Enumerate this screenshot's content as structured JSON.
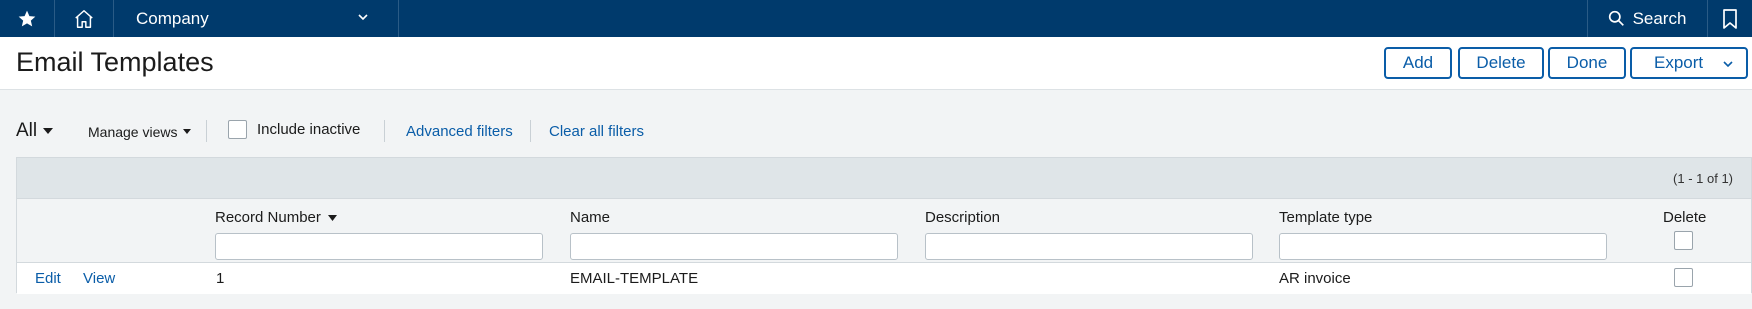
{
  "nav": {
    "star_icon": "star-icon",
    "home_icon": "home-icon",
    "company_label": "Company",
    "search_label": "Search",
    "bookmark_icon": "bookmark-icon"
  },
  "header": {
    "title": "Email Templates",
    "buttons": {
      "add": "Add",
      "delete": "Delete",
      "done": "Done",
      "export": "Export"
    }
  },
  "filters": {
    "view": "All",
    "manage_views": "Manage views",
    "include_inactive": "Include inactive",
    "advanced_filters": "Advanced filters",
    "clear_all_filters": "Clear all filters"
  },
  "grid": {
    "pager": "(1 - 1 of 1)",
    "columns": [
      "Record Number",
      "Name",
      "Description",
      "Template type",
      "Delete"
    ],
    "sorted_column": "Record Number",
    "rows": [
      {
        "edit": "Edit",
        "view": "View",
        "record_number": "1",
        "name": "EMAIL-TEMPLATE",
        "description": "",
        "template_type": "AR invoice",
        "delete": false
      }
    ]
  },
  "colors": {
    "nav_bg": "#003a6c",
    "accent": "#0a5da8"
  }
}
